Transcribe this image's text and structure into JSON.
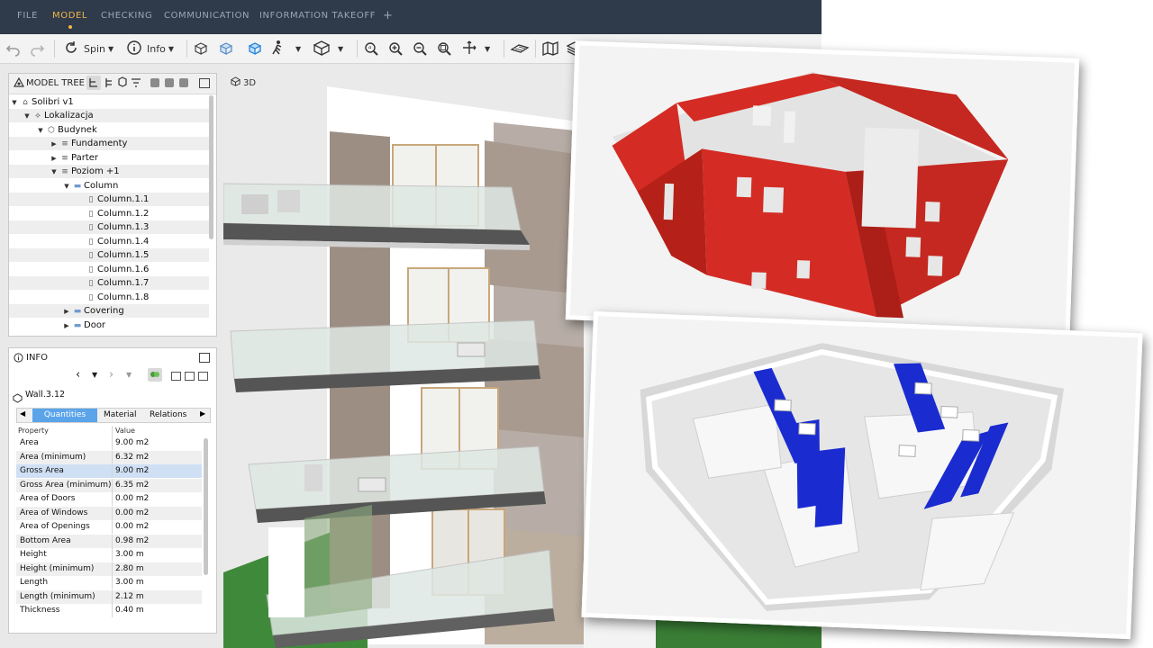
{
  "nav": {
    "tabs": [
      {
        "label": "FILE"
      },
      {
        "label": "MODEL",
        "active": true
      },
      {
        "label": "CHECKING"
      },
      {
        "label": "COMMUNICATION"
      },
      {
        "label": "INFORMATION TAKEOFF"
      }
    ],
    "add_label": "+"
  },
  "toolbar": {
    "spin_label": "Spin",
    "info_label": "Info"
  },
  "model_tree": {
    "title": "MODEL TREE",
    "rows": [
      {
        "label": "Solibri v1",
        "expanded": true,
        "icon": "model-icon"
      },
      {
        "label": "Lokalizacja",
        "expanded": true,
        "icon": "site-icon"
      },
      {
        "label": "Budynek",
        "expanded": true,
        "icon": "building-icon"
      },
      {
        "label": "Fundamenty",
        "expanded": false,
        "icon": "storey-icon"
      },
      {
        "label": "Parter",
        "expanded": false,
        "icon": "storey-icon"
      },
      {
        "label": "Poziom +1",
        "expanded": true,
        "icon": "storey-icon"
      },
      {
        "label": "Column",
        "expanded": true,
        "icon": "folder-icon"
      },
      {
        "label": "Column.1.1",
        "icon": "column-icon"
      },
      {
        "label": "Column.1.2",
        "icon": "column-icon"
      },
      {
        "label": "Column.1.3",
        "icon": "column-icon"
      },
      {
        "label": "Column.1.4",
        "icon": "column-icon"
      },
      {
        "label": "Column.1.5",
        "icon": "column-icon"
      },
      {
        "label": "Column.1.6",
        "icon": "column-icon"
      },
      {
        "label": "Column.1.7",
        "icon": "column-icon"
      },
      {
        "label": "Column.1.8",
        "icon": "column-icon"
      },
      {
        "label": "Covering",
        "expanded": false,
        "icon": "folder-icon"
      },
      {
        "label": "Door",
        "expanded": false,
        "icon": "folder-icon"
      }
    ]
  },
  "info": {
    "title": "INFO",
    "element_name": "Wall.3.12",
    "tabs": [
      {
        "label": "Quantities",
        "active": true
      },
      {
        "label": "Material"
      },
      {
        "label": "Relations"
      }
    ],
    "columns": [
      "Property",
      "Value"
    ],
    "rows": [
      {
        "property": "Area",
        "value": "9.00 m2"
      },
      {
        "property": "Area (minimum)",
        "value": "6.32 m2"
      },
      {
        "property": "Gross Area",
        "value": "9.00 m2",
        "selected": true
      },
      {
        "property": "Gross Area (minimum)",
        "value": "6.35 m2"
      },
      {
        "property": "Area of Doors",
        "value": "0.00 m2"
      },
      {
        "property": "Area of Windows",
        "value": "0.00 m2"
      },
      {
        "property": "Area of Openings",
        "value": "0.00 m2"
      },
      {
        "property": "Bottom Area",
        "value": "0.98 m2"
      },
      {
        "property": "Height",
        "value": "3.00 m"
      },
      {
        "property": "Height (minimum)",
        "value": "2.80 m"
      },
      {
        "property": "Length",
        "value": "3.00 m"
      },
      {
        "property": "Length (minimum)",
        "value": "2.12 m"
      },
      {
        "property": "Thickness",
        "value": "0.40 m"
      }
    ]
  },
  "viewport": {
    "label": "3D"
  },
  "colors": {
    "accent": "#f0b64a",
    "nav_bg": "#2f3a4a",
    "tab_active": "#5ba4ea",
    "highlight_red": "#d42c24",
    "highlight_blue": "#1a2bd0"
  }
}
